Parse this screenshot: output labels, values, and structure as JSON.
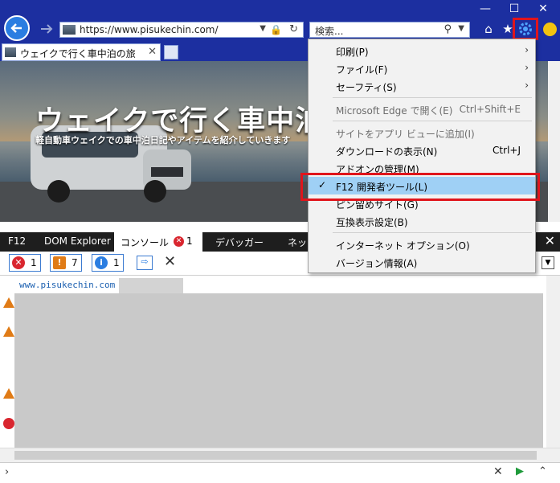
{
  "browser": {
    "address": "https://www.pisukechin.com/",
    "search_placeholder": "検索...",
    "tab_title": "ウェイクで行く車中泊の旅"
  },
  "page": {
    "hero_title": "ウェイクで行く車中泊の",
    "hero_subtitle": "軽自動車ウェイクでの車中泊日記やアイテムを紹介していきます"
  },
  "devtools": {
    "tabs": [
      "F12",
      "DOM Explorer",
      "コンソール",
      "デバッガー",
      "ネッ"
    ],
    "console_error_badge": "1",
    "counts": {
      "errors": "1",
      "warnings": "7",
      "info": "1"
    },
    "console_url": "www.pisukechin.com"
  },
  "menu": {
    "items": [
      {
        "label": "印刷(P)"
      },
      {
        "label": "ファイル(F)"
      },
      {
        "label": "セーフティ(S)"
      },
      {
        "label": "Microsoft Edge で開く(E)",
        "shortcut": "Ctrl+Shift+E"
      },
      {
        "label": "サイトをアプリ ビューに追加(I)"
      },
      {
        "label": "ダウンロードの表示(N)",
        "shortcut": "Ctrl+J"
      },
      {
        "label": "アドオンの管理(M)"
      },
      {
        "label": "F12 開発者ツール(L)"
      },
      {
        "label": "ピン留めサイト(G)"
      },
      {
        "label": "互換表示設定(B)"
      },
      {
        "label": "インターネット オプション(O)"
      },
      {
        "label": "バージョン情報(A)"
      }
    ]
  },
  "colors": {
    "chrome_blue": "#1c2fa0",
    "highlight_red": "#e0151c",
    "menu_selected": "#9fd0f5"
  }
}
